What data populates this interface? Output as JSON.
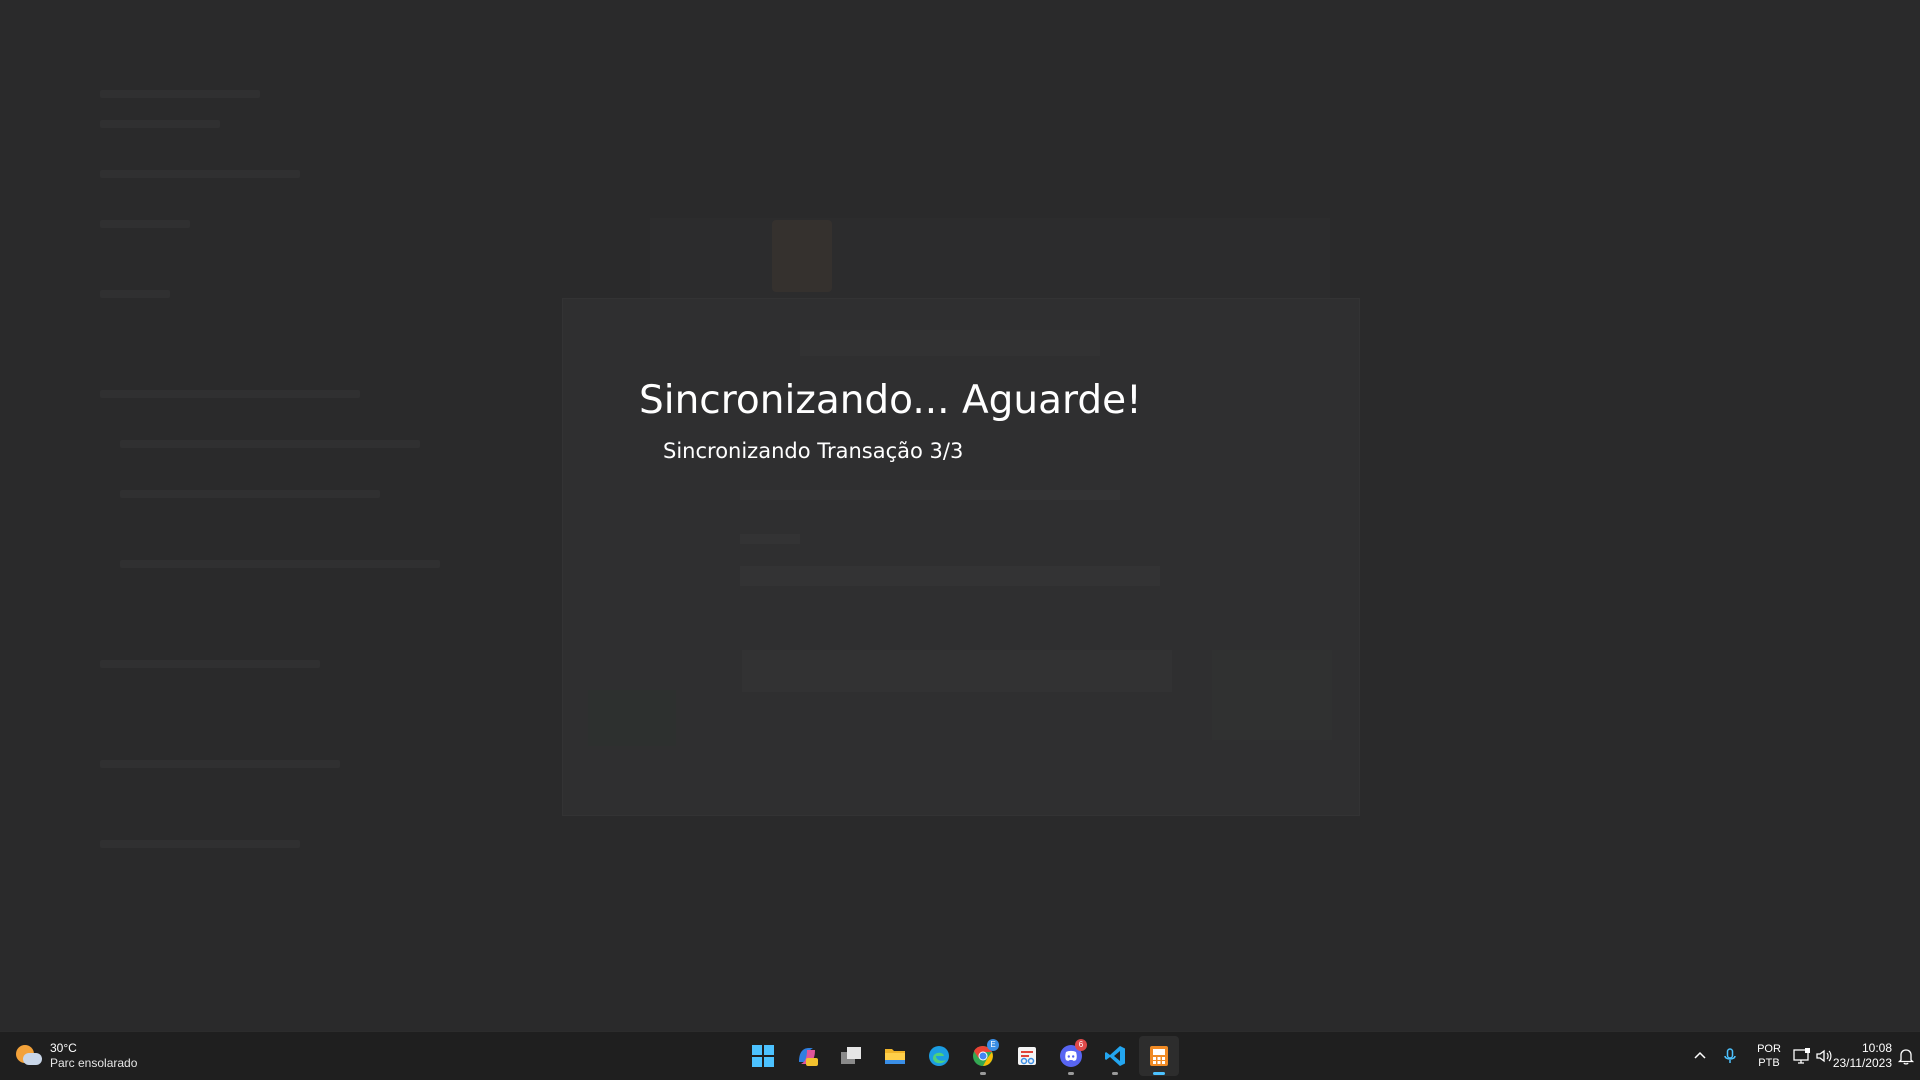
{
  "overlay": {
    "title": "Sincronizando... Aguarde!",
    "subtitle": "Sincronizando Transação 3/3"
  },
  "taskbar": {
    "weather": {
      "temperature": "30°C",
      "description": "Parc ensolarado",
      "icon": "partly-sunny-icon"
    },
    "apps": [
      {
        "name": "start",
        "icon": "windows-start-icon"
      },
      {
        "name": "copilot",
        "icon": "copilot-icon"
      },
      {
        "name": "task-view",
        "icon": "task-view-icon"
      },
      {
        "name": "file-explorer",
        "icon": "folder-icon"
      },
      {
        "name": "edge",
        "icon": "edge-icon"
      },
      {
        "name": "chrome",
        "icon": "chrome-icon",
        "badge": "E"
      },
      {
        "name": "snipping-tool",
        "icon": "snipping-tool-icon"
      },
      {
        "name": "discord",
        "icon": "discord-icon",
        "badge": "6"
      },
      {
        "name": "vscode",
        "icon": "vscode-icon"
      },
      {
        "name": "pdv",
        "icon": "pdv-app-icon",
        "active": true
      }
    ],
    "tray": {
      "language_line1": "POR",
      "language_line2": "PTB",
      "time": "10:08",
      "date": "23/11/2023"
    }
  },
  "colors": {
    "accent": "#4cc2ff",
    "taskbar": "#1f1f1f",
    "dim_background": "#2a2a2b"
  }
}
